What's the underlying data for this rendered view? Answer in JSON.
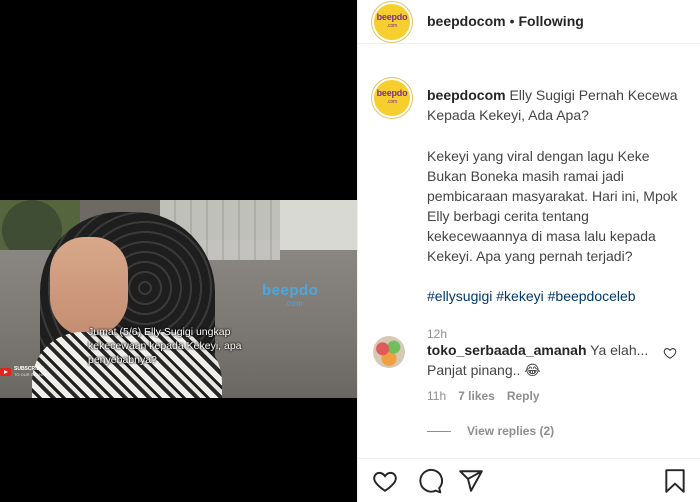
{
  "media": {
    "caption": "Jumat (5/6) Elly Sugigi ungkap kekecewaan kepada Kekeyi, apa penyebabnya?",
    "watermark": "beepdo",
    "watermark_sub": ".com",
    "subscribe_label": "SUBSCRIBE",
    "subscribe_sub": "TO OUR CHANNEL"
  },
  "header": {
    "avatar_logo": "beepdo",
    "avatar_logo_sub": ".com",
    "username": "beepdocom",
    "separator": "•",
    "follow_status": "Following"
  },
  "post": {
    "author": "beepdocom",
    "title": "Elly Sugigi Pernah Kecewa Kepada Kekeyi, Ada Apa?",
    "body": "Kekeyi yang viral dengan lagu Keke Bukan Boneka masih ramai jadi pembicaraan masyarakat. Hari ini, Mpok Elly berbagi cerita tentang kekecewaannya di masa lalu kepada Kekeyi. Apa yang pernah terjadi?",
    "hashtags": "#ellysugigi #kekeyi #beepdoceleb",
    "age": "12h"
  },
  "comment": {
    "username": "toko_serbaada_amanah",
    "text": "Ya elah... Panjat pinang.. 😂",
    "age": "11h",
    "likes": "7 likes",
    "reply_label": "Reply",
    "view_replies": "View replies (2)"
  },
  "icons": [
    "heart-icon",
    "comment-icon",
    "share-icon",
    "bookmark-icon",
    "small-heart-icon"
  ],
  "colors": {
    "link": "#00376b",
    "muted": "#8e8e8e",
    "avatar_bg": "#f6ce2d"
  }
}
